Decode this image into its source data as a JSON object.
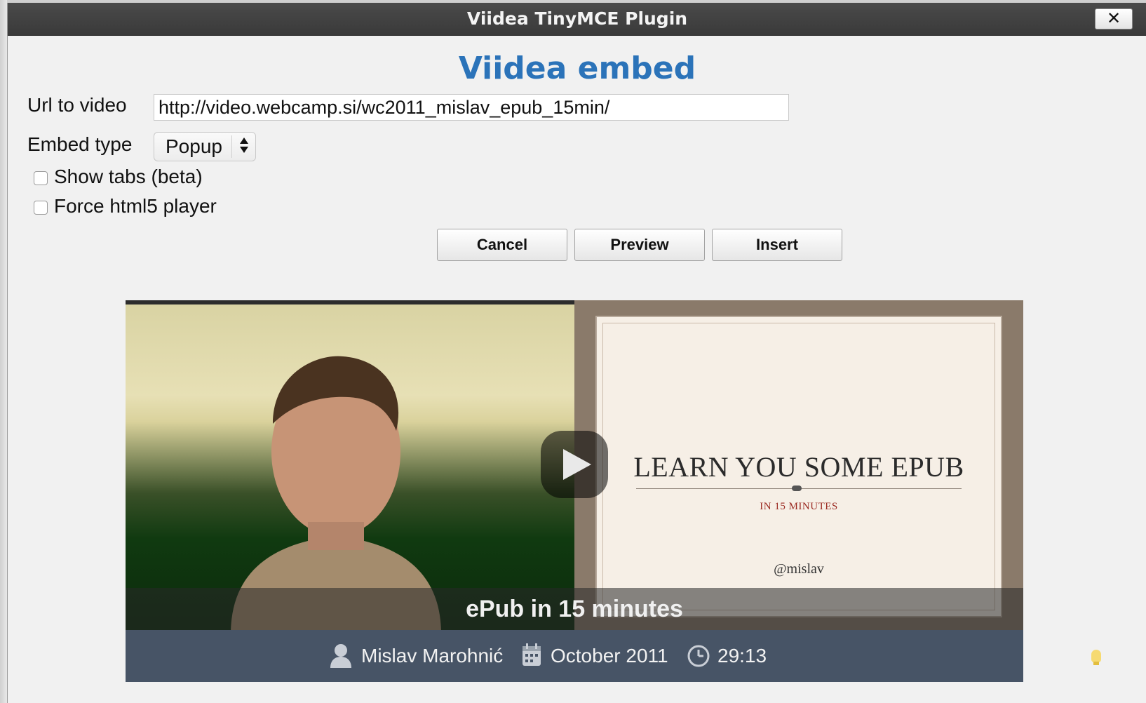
{
  "window": {
    "title": "Viidea TinyMCE Plugin",
    "close_label": "✕"
  },
  "form": {
    "heading": "Viidea embed",
    "url_label": "Url to video",
    "url_value": "http://video.webcamp.si/wc2011_mislav_epub_15min/",
    "embed_type_label": "Embed type",
    "embed_type_value": "Popup",
    "embed_type_arrows": "▲▼",
    "show_tabs_label": "Show tabs (beta)",
    "show_tabs_checked": false,
    "force_html5_label": "Force html5 player",
    "force_html5_checked": false
  },
  "buttons": {
    "cancel": "Cancel",
    "preview": "Preview",
    "insert": "Insert"
  },
  "player": {
    "slide_title": "LEARN YOU SOME EPUB",
    "slide_subtitle": "IN 15 MINUTES",
    "slide_handle": "@mislav",
    "caption": "ePub in 15 minutes",
    "author": "Mislav Marohnić",
    "date": "October 2011",
    "duration": "29:13",
    "icons": [
      "person-icon",
      "calendar-icon",
      "clock-icon",
      "play-icon",
      "lightbulb-icon"
    ]
  },
  "colors": {
    "heading": "#2b73b9",
    "titlebar": "#3f3f3f",
    "infobar": "#475466",
    "dialog_bg": "#f1f1f1"
  }
}
